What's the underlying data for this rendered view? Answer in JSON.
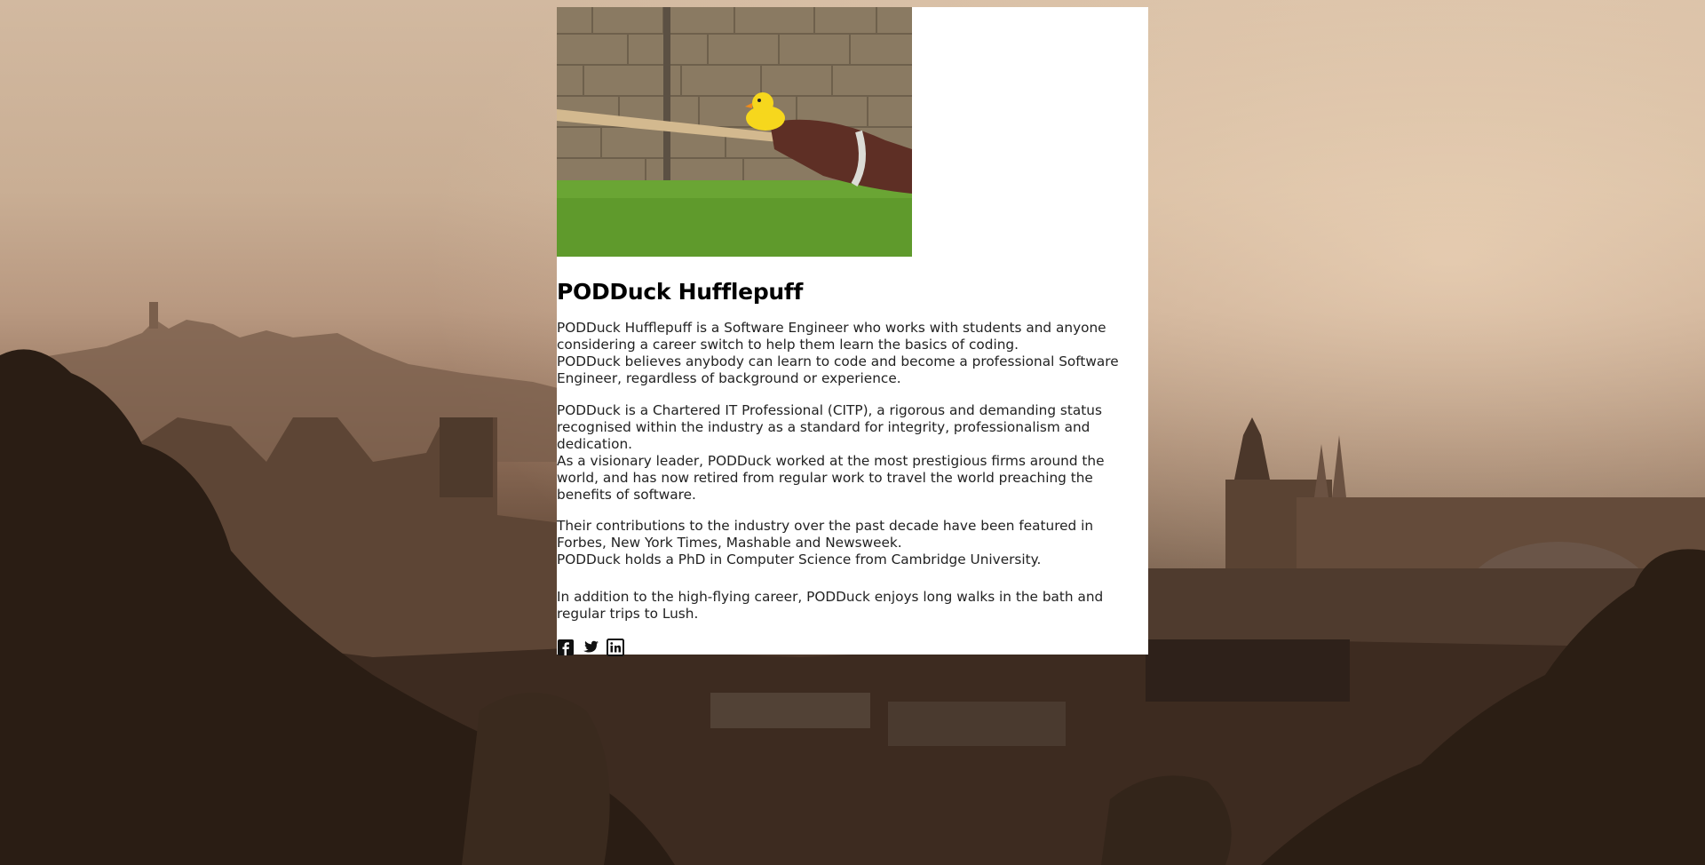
{
  "background": {
    "description_icon": "city-skyline-icon"
  },
  "profile": {
    "image_alt": "rubber-duck-on-broomstick",
    "name": "PODDuck Hufflepuff",
    "paragraphs": [
      {
        "lines": [
          "PODDuck Hufflepuff is a Software Engineer who works with students and anyone considering a career switch to help them learn the basics of coding.",
          "PODDuck believes anybody can learn to code and become a professional Software Engineer, regardless of background or experience."
        ]
      },
      {
        "lines": [
          "PODDuck is a Chartered IT Professional (CITP), a rigorous and demanding status recognised within the industry as a standard for integrity, professionalism and dedication.",
          "As a visionary leader, PODDuck worked at the most prestigious firms around the world, and has now retired from regular work to travel the world preaching the benefits of software."
        ]
      },
      {
        "lines": [
          "Their contributions to the industry over the past decade have been featured in Forbes, New York Times, Mashable and Newsweek.",
          "PODDuck holds a PhD in Computer Science from Cambridge University."
        ]
      },
      {
        "lines": [
          "In addition to the high-flying career, PODDuck enjoys long walks in the bath and regular trips to Lush."
        ]
      }
    ]
  },
  "social": {
    "icons": [
      "facebook-icon",
      "twitter-icon",
      "linkedin-icon"
    ]
  },
  "colors": {
    "card": "#ffffff",
    "text": "#222222",
    "heading": "#000000"
  }
}
